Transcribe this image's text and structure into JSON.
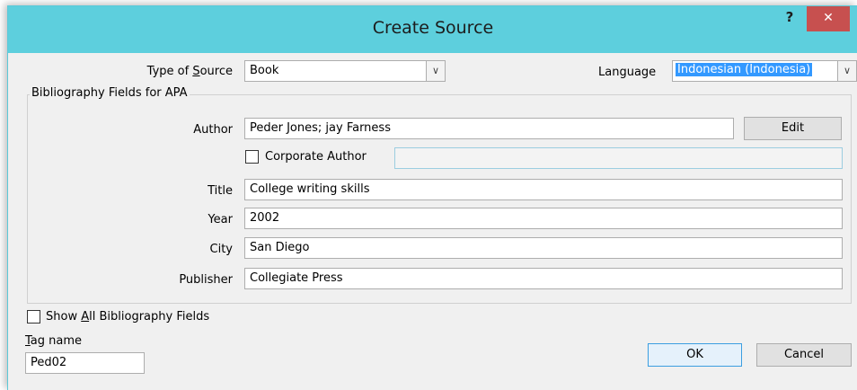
{
  "window": {
    "title": "Create Source",
    "help_label": "?",
    "close_label": "✕"
  },
  "source": {
    "type_label_pre": "Type of ",
    "type_label_key": "S",
    "type_label_post": "ource",
    "type_value": "Book",
    "language_label": "Language",
    "language_value": "Indonesian (Indonesia)"
  },
  "group": {
    "label": "Bibliography Fields for APA"
  },
  "fields": {
    "author_label": "Author",
    "author_value": "Peder Jones; jay Farness",
    "edit_label": "Edit",
    "corporate_label": "Corporate Author",
    "title_label": "Title",
    "title_value": "College writing skills",
    "year_label": "Year",
    "year_value": "2002",
    "city_label": "City",
    "city_value": "San Diego",
    "publisher_label": "Publisher",
    "publisher_value": "Collegiate Press"
  },
  "bottom": {
    "show_all_pre": "Show ",
    "show_all_key": "A",
    "show_all_post": "ll Bibliography Fields",
    "tag_label_key": "T",
    "tag_label_post": "ag name",
    "tag_value": "Ped02",
    "ok_label": "OK",
    "cancel_label": "Cancel"
  },
  "icons": {
    "dropdown": "chevron-down-icon",
    "close": "close-icon",
    "help": "help-icon"
  }
}
